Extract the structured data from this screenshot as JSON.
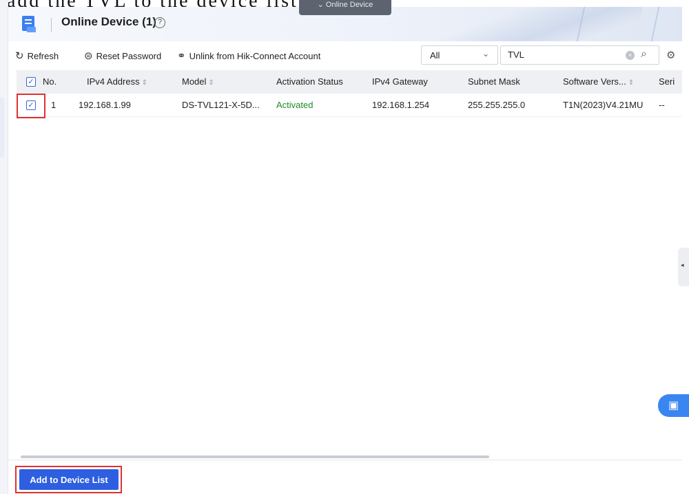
{
  "caption": "add the TVL to the device list.",
  "header": {
    "title": "Online Device (1)",
    "help_icon": "help-circle-icon",
    "tooltip": "Online Device"
  },
  "toolbar": {
    "refresh_label": "Refresh",
    "reset_password_label": "Reset Password",
    "unlink_label": "Unlink from Hik-Connect Account",
    "filter_value": "All",
    "search_value": "TVL"
  },
  "table": {
    "headers": {
      "no": "No.",
      "ipv4": "IPv4 Address",
      "model": "Model",
      "activation": "Activation Status",
      "gateway": "IPv4 Gateway",
      "subnet": "Subnet Mask",
      "software": "Software Vers...",
      "serial": "Seri"
    },
    "rows": [
      {
        "checked": true,
        "no": "1",
        "ipv4": "192.168.1.99",
        "model": "DS-TVL121-X-5D...",
        "activation": "Activated",
        "gateway": "192.168.1.254",
        "subnet": "255.255.255.0",
        "software": "T1N(2023)V4.21MU",
        "serial": "--"
      }
    ]
  },
  "footer": {
    "add_button_label": "Add to Device List"
  },
  "colors": {
    "accent": "#2e5fe0",
    "activated": "#1f8a28",
    "highlight_box": "#e03030"
  }
}
